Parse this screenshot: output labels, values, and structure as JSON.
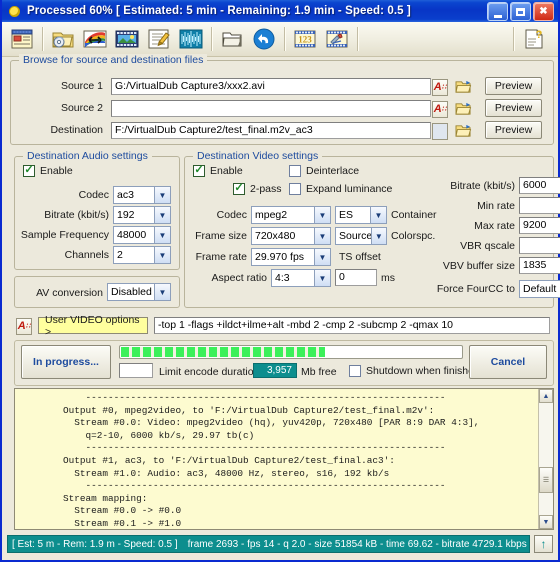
{
  "window": {
    "title": "Processed  60%  [ Estimated: 5 min - Remaining: 1.9 min - Speed: 0.5 ]",
    "minimize_label": "Minimize",
    "maximize_label": "Maximize",
    "close_label": "Close"
  },
  "toolbar": {
    "items": [
      {
        "name": "settings-window-icon",
        "tip": "Settings"
      },
      {
        "name": "open-folder-disc-icon",
        "tip": "Open project"
      },
      {
        "name": "color-convert-icon",
        "tip": "Color conversion"
      },
      {
        "name": "film-image-icon",
        "tip": "Video filters"
      },
      {
        "name": "edit-note-icon",
        "tip": "Edit script"
      },
      {
        "name": "waveform-icon",
        "tip": "Audio"
      },
      {
        "name": "folder-out-icon",
        "tip": "Output folder"
      },
      {
        "name": "undo-arrow-icon",
        "tip": "Reset"
      },
      {
        "name": "film-123-icon",
        "tip": "Batch"
      },
      {
        "name": "film-tools-icon",
        "tip": "Tools"
      },
      {
        "name": "help-document-icon",
        "tip": "Help"
      }
    ]
  },
  "browse": {
    "legend": "Browse for source and destination files",
    "rows": [
      {
        "label": "Source 1",
        "value": "G:/VirtualDub Capture3/xxx2.avi",
        "has_af": true,
        "af_label": "A",
        "preview_label": "Preview",
        "folder_icon": "open-folder-icon"
      },
      {
        "label": "Source 2",
        "value": "",
        "has_af": true,
        "af_label": "A",
        "preview_label": "Preview",
        "folder_icon": "open-folder-icon"
      },
      {
        "label": "Destination",
        "value": "F:/VirtualDub Capture2/test_final.m2v_ac3",
        "has_af": false,
        "af_label": "",
        "preview_label": "Preview",
        "folder_icon": "open-folder-icon"
      }
    ]
  },
  "audio": {
    "legend": "Destination Audio settings",
    "enable_label": "Enable",
    "enable_checked": true,
    "fields": [
      {
        "label": "Codec",
        "value": "ac3"
      },
      {
        "label": "Bitrate (kbit/s)",
        "value": "192"
      },
      {
        "label": "Sample Frequency",
        "value": "48000"
      },
      {
        "label": "Channels",
        "value": "2"
      }
    ],
    "av_conversion_label": "AV conversion",
    "av_conversion_value": "Disabled"
  },
  "video": {
    "legend": "Destination Video settings",
    "enable_label": "Enable",
    "enable_checked": true,
    "two_pass_label": "2-pass",
    "two_pass_checked": true,
    "deinterlace_label": "Deinterlace",
    "deinterlace_checked": false,
    "expand_luminance_label": "Expand luminance",
    "expand_luminance_checked": false,
    "codec_label": "Codec",
    "codec_value": "mpeg2",
    "container_value": "ES",
    "container_label": "Container",
    "frame_size_label": "Frame size",
    "frame_size_value": "720x480",
    "colorspc_value": "Source",
    "colorspc_label": "Colorspc.",
    "frame_rate_label": "Frame rate",
    "frame_rate_value": "29.970 fps",
    "aspect_ratio_label": "Aspect ratio",
    "aspect_ratio_value": "4:3",
    "ts_offset_label": "TS offset",
    "ts_offset_value": "0",
    "ts_offset_unit": "ms",
    "rates": [
      {
        "label": "Bitrate (kbit/s)",
        "value": "6000"
      },
      {
        "label": "Min rate",
        "value": ""
      },
      {
        "label": "Max rate",
        "value": "9200"
      },
      {
        "label": "VBR qscale",
        "value": ""
      },
      {
        "label": "VBV buffer size",
        "value": "1835"
      }
    ],
    "fourcc_label": "Force FourCC to",
    "fourcc_value": "Default"
  },
  "user_options": {
    "af_label": "A",
    "button_label": "User VIDEO options >",
    "value": "-top 1 -flags +ildct+ilme+alt -mbd 2 -cmp 2 -subcmp 2 -qmax 10"
  },
  "encode": {
    "in_progress_label": "In progress...",
    "cancel_label": "Cancel",
    "progress_percent": 60,
    "limit_duration_label": "Limit encode duration",
    "limit_duration_value": "",
    "mb_free_value": "3,957",
    "mb_free_label": "Mb free",
    "shutdown_label": "Shutdown when finished",
    "shutdown_checked": false
  },
  "log": {
    "lines": [
      "    ----------------------------------------------------------------",
      "Output #0, mpeg2video, to 'F:/VirtualDub Capture2/test_final.m2v':",
      "  Stream #0.0: Video: mpeg2video (hq), yuv420p, 720x480 [PAR 8:9 DAR 4:3],",
      "    q=2-10, 6000 kb/s, 29.97 tb(c)",
      "    ----------------------------------------------------------------",
      "Output #1, ac3, to 'F:/VirtualDub Capture2/test_final.ac3':",
      "  Stream #1.0: Audio: ac3, 48000 Hz, stereo, s16, 192 kb/s",
      "    ----------------------------------------------------------------",
      "Stream mapping:",
      "  Stream #0.0 -> #0.0",
      "  Stream #0.1 -> #1.0"
    ]
  },
  "statusbar": {
    "estimate": "[ Est: 5 m - Rem: 1.9 m - Speed: 0.5 ]",
    "stats": "frame 2693 - fps 14 - q 2.0 - size 51854 kB - time 69.62 - bitrate 4729.1 kbps",
    "up_icon": "up-arrow-icon"
  },
  "colors": {
    "title_blue": "#0a35c6",
    "teal": "#0d8e8e",
    "legend_blue": "#1d4b9e",
    "progress_green": "#3cf05a",
    "log_bg": "#fdfbd0",
    "yellow_btn": "#ffff9e"
  }
}
